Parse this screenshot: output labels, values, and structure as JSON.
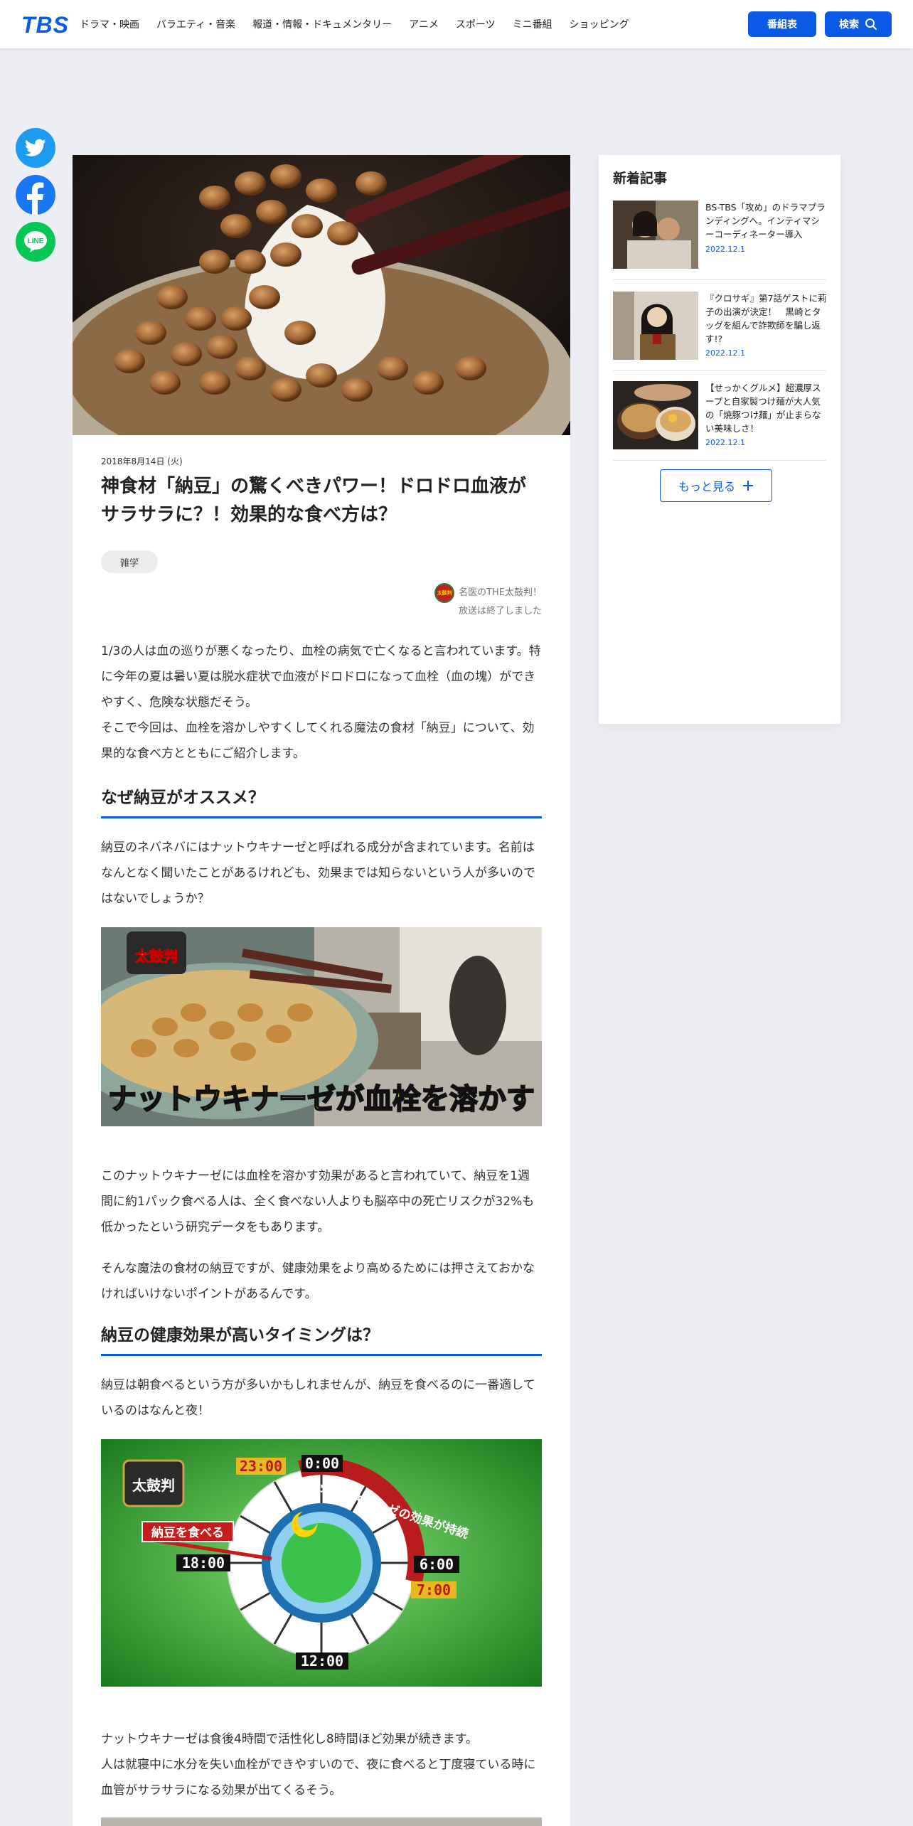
{
  "header": {
    "logo": "TBS",
    "nav": [
      "ドラマ・映画",
      "バラエティ・音楽",
      "報道・情報・ドキュメンタリー",
      "アニメ",
      "スポーツ",
      "ミニ番組",
      "ショッピング"
    ],
    "bangumi_label": "番組表",
    "search_label": "検索"
  },
  "social": {
    "twitter": "twitter-icon",
    "facebook": "facebook-icon",
    "line_label": "LINE"
  },
  "article": {
    "date": "2018年8月14日 (火)",
    "title": "神食材「納豆」の驚くべきパワー！ドロドロ血液がサラサラに？！効果的な食べ方は？",
    "tag": "雑学",
    "program_name": "名医のTHE太鼓判！",
    "program_status": "放送は終了しました",
    "intro": "1/3の人は血の巡りが悪くなったり、血栓の病気で亡くなると言われています。特に今年の夏は暑い夏は脱水症状で血液がドロドロになって血栓（血の塊）ができやすく、危険な状態だそう。",
    "intro2": "そこで今回は、血栓を溶かしやすくしてくれる魔法の食材「納豆」について、効果的な食べ方とともにご紹介します。",
    "section1": "なぜ納豆がオススメ？",
    "s1p1": "納豆のネバネバにはナットウキナーゼと呼ばれる成分が含まれています。名前はなんとなく聞いたことがあるけれども、効果までは知らないという人が多いのではないでしょうか？",
    "caption1": "ナットウキナーゼが血栓を溶かす",
    "s1p2": "このナットウキナーゼには血栓を溶かす効果があると言われていて、納豆を1週間に約1パック食べる人は、全く食べない人よりも脳卒中の死亡リスクが32%も低かったという研究データをもあります。",
    "s1p3": "そんな魔法の食材の納豆ですが、健康効果をより高めるためには押さえておかなければいけないポイントがあるんです。",
    "section2": "納豆の健康効果が高いタイミングは？",
    "s2p1": "納豆は朝食べるという方が多いかもしれませんが、納豆を食べるのに一番適しているのはなんと夜！",
    "clock": {
      "t0": "0:00",
      "t23": "23:00",
      "t6": "6:00",
      "t7": "7:00",
      "t18": "18:00",
      "t12": "12:00",
      "eat": "納豆を食べる",
      "effect": "ナットウキナーゼの効果が持続",
      "logo": "太鼓判"
    },
    "s2p2": "ナットウキナーゼは食後4時間で活性化し8時間ほど効果が続きます。",
    "s2p3": "人は就寝中に水分を失い血栓ができやすいので、夜に食べると丁度寝ている時に血管がサラサラになる効果が出てくるそう。",
    "logo_badge": "太鼓判"
  },
  "sidebar": {
    "title": "新着記事",
    "items": [
      {
        "text": "BS-TBS「攻め」のドラマプランディングへ。インティマシーコーディネーター導入",
        "date": "2022.12.1"
      },
      {
        "text": "『クロサギ』第7話ゲストに莉子の出演が決定！　黒崎とタッグを組んで詐欺師を騙し返す!?",
        "date": "2022.12.1"
      },
      {
        "text": "【せっかくグルメ】超濃厚スープと自家製つけ麺が大人気の「焼豚つけ麺」が止まらない美味しさ！",
        "date": "2022.12.1"
      }
    ],
    "more": "もっと見る"
  }
}
